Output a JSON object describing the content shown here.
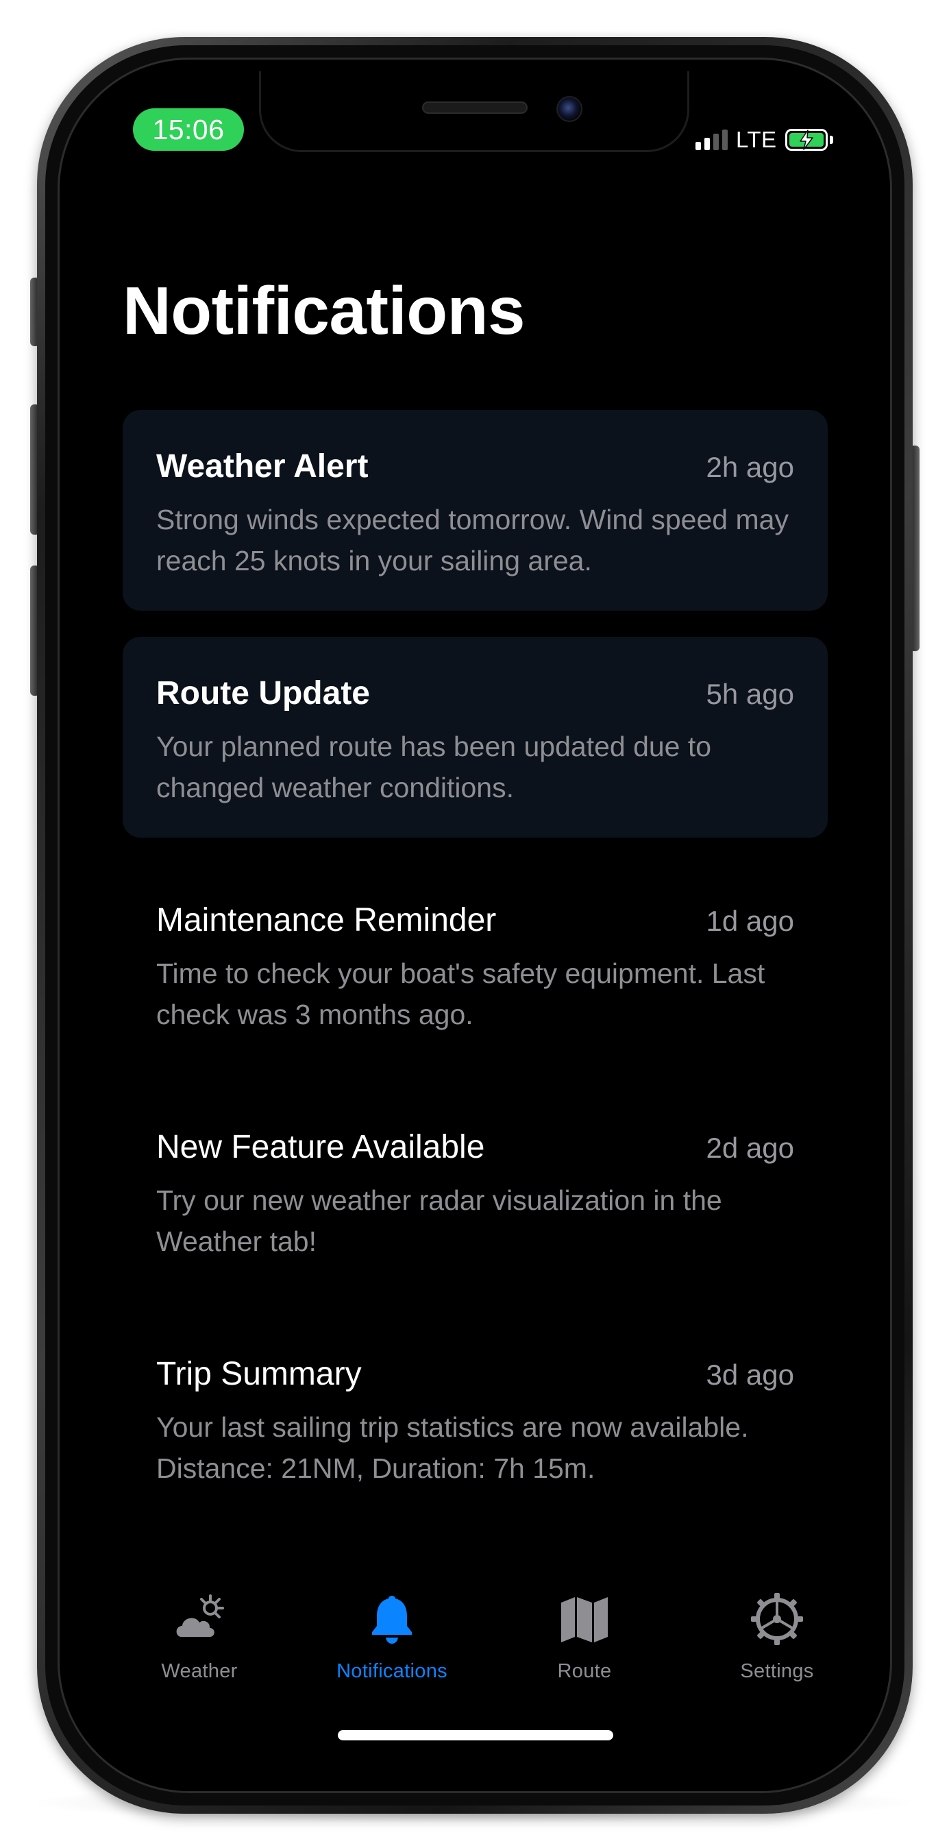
{
  "status_bar": {
    "time": "15:06",
    "network": "LTE",
    "signal_bars_active": 2,
    "signal_bars_total": 4,
    "battery_charging": true,
    "time_pill_color": "#30d158"
  },
  "page": {
    "title": "Notifications"
  },
  "notifications": [
    {
      "title": "Weather Alert",
      "time": "2h ago",
      "body": "Strong winds expected tomorrow. Wind speed may reach 25 knots in your sailing area.",
      "unread": true
    },
    {
      "title": "Route Update",
      "time": "5h ago",
      "body": "Your planned route has been updated due to changed weather conditions.",
      "unread": true
    },
    {
      "title": "Maintenance Reminder",
      "time": "1d ago",
      "body": "Time to check your boat's safety equipment. Last check was 3 months ago.",
      "unread": false
    },
    {
      "title": "New Feature Available",
      "time": "2d ago",
      "body": "Try our new weather radar visualization in the Weather tab!",
      "unread": false
    },
    {
      "title": "Trip Summary",
      "time": "3d ago",
      "body": "Your last sailing trip statistics are now available. Distance: 21NM, Duration: 7h 15m.",
      "unread": false
    }
  ],
  "tab_bar": {
    "active_color": "#0a84ff",
    "inactive_color": "#8e8e93",
    "tabs": [
      {
        "label": "Weather",
        "icon": "cloud-sun-icon",
        "active": false
      },
      {
        "label": "Notifications",
        "icon": "bell-icon",
        "active": true
      },
      {
        "label": "Route",
        "icon": "map-icon",
        "active": false
      },
      {
        "label": "Settings",
        "icon": "gear-icon",
        "active": false
      }
    ]
  }
}
